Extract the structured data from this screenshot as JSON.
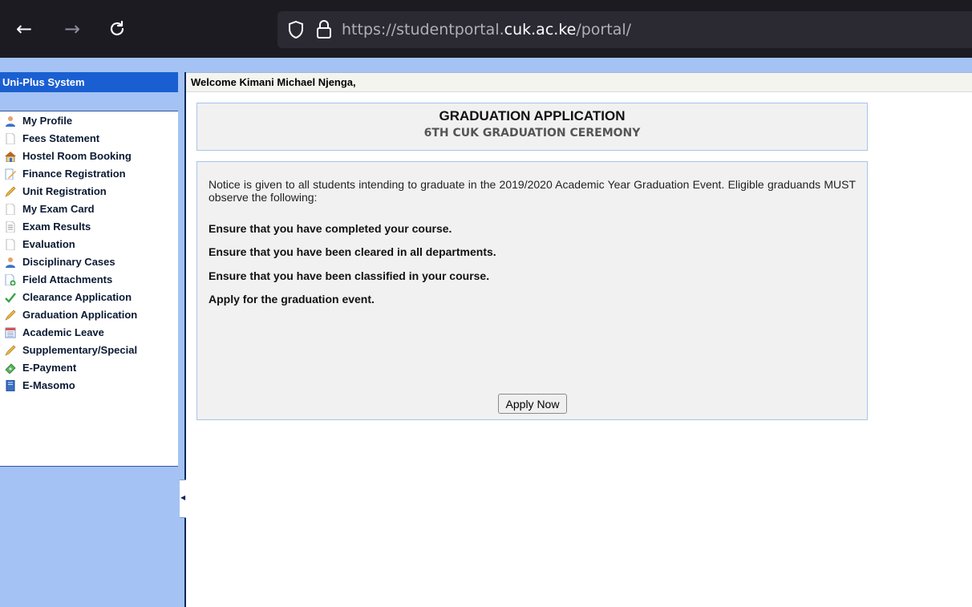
{
  "browser": {
    "url_prefix": "https://studentportal.",
    "url_domain": "cuk.ac.ke",
    "url_suffix": "/portal/",
    "back_glyph": "←",
    "forward_glyph": "→",
    "reload_glyph": "C"
  },
  "sidebar": {
    "title": "Uni-Plus System",
    "items": [
      {
        "label": "My Profile",
        "icon": "user-icon"
      },
      {
        "label": "Fees Statement",
        "icon": "document-icon"
      },
      {
        "label": "Hostel Room Booking",
        "icon": "house-icon"
      },
      {
        "label": "Finance Registration",
        "icon": "edit-document-icon"
      },
      {
        "label": "Unit Registration",
        "icon": "pencil-icon"
      },
      {
        "label": "My Exam Card",
        "icon": "document-icon"
      },
      {
        "label": "Exam Results",
        "icon": "text-document-icon"
      },
      {
        "label": "Evaluation",
        "icon": "document-icon"
      },
      {
        "label": "Disciplinary Cases",
        "icon": "user-icon"
      },
      {
        "label": "Field Attachments",
        "icon": "document-add-icon"
      },
      {
        "label": "Clearance Application",
        "icon": "checkmark-icon"
      },
      {
        "label": "Graduation Application",
        "icon": "pencil-icon"
      },
      {
        "label": "Academic Leave",
        "icon": "calendar-icon"
      },
      {
        "label": "Supplementary/Special",
        "icon": "pencil-icon"
      },
      {
        "label": "E-Payment",
        "icon": "money-icon"
      },
      {
        "label": "E-Masomo",
        "icon": "book-icon"
      }
    ]
  },
  "main": {
    "welcome": "Welcome Kimani Michael Njenga,",
    "heading": "GRADUATION APPLICATION",
    "subheading": "6TH CUK GRADUATION CEREMONY",
    "notice": "Notice is given to all students intending to graduate in the 2019/2020 Academic Year Graduation Event. Eligible graduands MUST observe the following:",
    "requirements": [
      "Ensure that you have completed your course.",
      "Ensure that you have been cleared in all departments.",
      "Ensure that you have been classified in your course.",
      "Apply for the graduation event."
    ],
    "apply_button": "Apply Now"
  },
  "colors": {
    "sidebar_bg": "#a4c2f4",
    "sidebar_title_bg": "#1a5fd1",
    "browser_bg": "#1c1b22",
    "panel_border": "#a9c4ea"
  }
}
